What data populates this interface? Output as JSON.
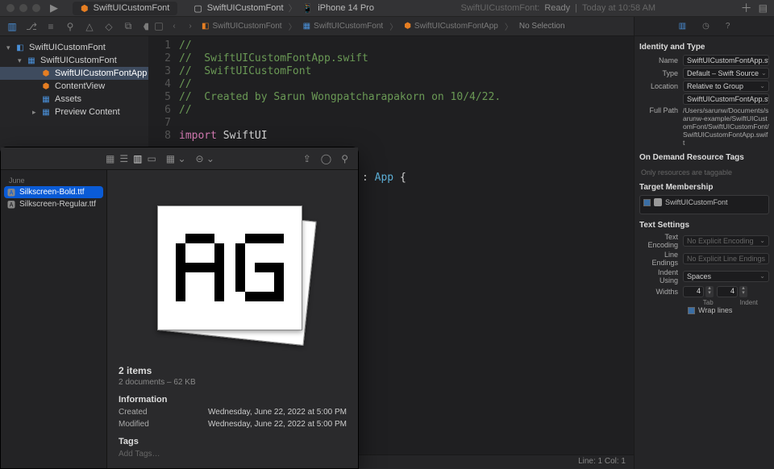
{
  "titlebar": {
    "scheme_target": "SwiftUICustomFont",
    "scheme_device": "iPhone 14 Pro",
    "status_prefix": "SwiftUICustomFont:",
    "status_main": "Ready",
    "status_time": "Today at 10:58 AM"
  },
  "navigator": {
    "root": "SwiftUICustomFont",
    "group": "SwiftUICustomFont",
    "items": [
      {
        "name": "SwiftUICustomFontApp",
        "kind": "swift",
        "selected": true
      },
      {
        "name": "ContentView",
        "kind": "swift",
        "selected": false
      },
      {
        "name": "Assets",
        "kind": "assets",
        "selected": false
      },
      {
        "name": "Preview Content",
        "kind": "folder",
        "selected": false
      }
    ]
  },
  "breadcrumb": {
    "a": "SwiftUICustomFont",
    "b": "SwiftUICustomFont",
    "c": "SwiftUICustomFontApp",
    "d": "No Selection"
  },
  "code": {
    "lines": [
      {
        "n": 1,
        "seg": [
          {
            "c": "tok-comment",
            "t": "//"
          }
        ]
      },
      {
        "n": 2,
        "seg": [
          {
            "c": "tok-comment",
            "t": "//  SwiftUICustomFontApp.swift"
          }
        ]
      },
      {
        "n": 3,
        "seg": [
          {
            "c": "tok-comment",
            "t": "//  SwiftUICustomFont"
          }
        ]
      },
      {
        "n": 4,
        "seg": [
          {
            "c": "tok-comment",
            "t": "//"
          }
        ]
      },
      {
        "n": 5,
        "seg": [
          {
            "c": "tok-comment",
            "t": "//  Created by Sarun Wongpatcharapakorn on 10/4/22."
          }
        ]
      },
      {
        "n": 6,
        "seg": [
          {
            "c": "tok-comment",
            "t": "//"
          }
        ]
      },
      {
        "n": 7,
        "seg": []
      },
      {
        "n": 8,
        "seg": [
          {
            "c": "tok-keyword",
            "t": "import"
          },
          {
            "c": "tok-plain",
            "t": " SwiftUI"
          }
        ]
      },
      {
        "n": "",
        "seg": [
          {
            "c": "tok-plain",
            "t": "                             : "
          },
          {
            "c": "tok-type",
            "t": "App"
          },
          {
            "c": "tok-plain",
            "t": " {"
          }
        ]
      }
    ],
    "status": "Line: 1  Col: 1"
  },
  "inspector": {
    "identity_heading": "Identity and Type",
    "name_label": "Name",
    "name_value": "SwiftUICustomFontApp.swift",
    "type_label": "Type",
    "type_value": "Default – Swift Source",
    "location_label": "Location",
    "location_value": "Relative to Group",
    "location_file": "SwiftUICustomFontApp.swift",
    "fullpath_label": "Full Path",
    "fullpath_value": "/Users/sarunw/Documents/sarunw-example/SwiftUICustomFont/SwiftUICustomFont/SwiftUICustomFontApp.swift",
    "ondemand_heading": "On Demand Resource Tags",
    "ondemand_placeholder": "Only resources are taggable",
    "target_heading": "Target Membership",
    "target_name": "SwiftUICustomFont",
    "text_heading": "Text Settings",
    "encoding_label": "Text Encoding",
    "encoding_value": "No Explicit Encoding",
    "lineend_label": "Line Endings",
    "lineend_value": "No Explicit Line Endings",
    "indent_label": "Indent Using",
    "indent_value": "Spaces",
    "widths_label": "Widths",
    "width_tab": "4",
    "width_indent": "4",
    "width_tab_sub": "Tab",
    "width_indent_sub": "Indent",
    "wrap_label": "Wrap lines"
  },
  "finder": {
    "sidebar_heading": "June",
    "files": [
      {
        "name": "Silkscreen-Bold.ttf",
        "selected": true
      },
      {
        "name": "Silkscreen-Regular.ttf",
        "selected": false
      }
    ],
    "items_count": "2 items",
    "items_sub": "2 documents – 62 KB",
    "info_heading": "Information",
    "created_label": "Created",
    "created_value": "Wednesday, June 22, 2022 at 5:00 PM",
    "modified_label": "Modified",
    "modified_value": "Wednesday, June 22, 2022 at 5:00 PM",
    "tags_heading": "Tags",
    "tags_placeholder": "Add Tags…"
  }
}
